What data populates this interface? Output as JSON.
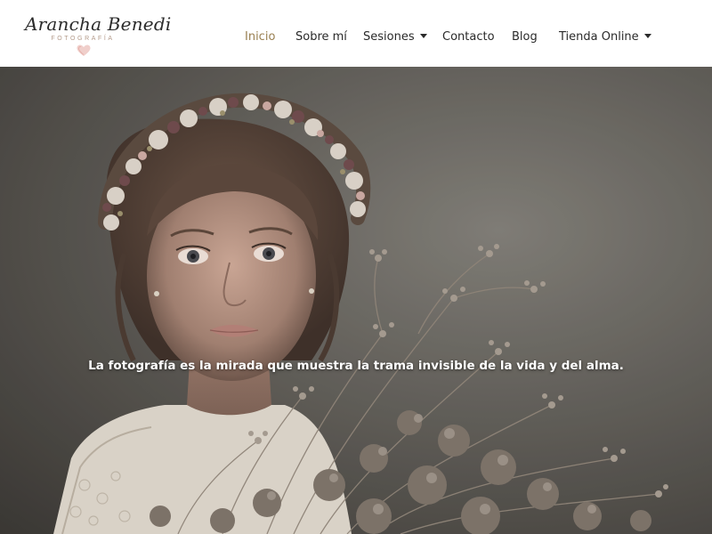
{
  "logo": {
    "name": "Arancha Benedi",
    "subtitle": "FOTOGRAFÍA"
  },
  "nav": {
    "items": [
      {
        "label": "Inicio",
        "active": true,
        "has_dropdown": false
      },
      {
        "label": "Sobre mí",
        "active": false,
        "has_dropdown": false
      },
      {
        "label": "Sesiones",
        "active": false,
        "has_dropdown": true
      },
      {
        "label": "Contacto",
        "active": false,
        "has_dropdown": false
      },
      {
        "label": "Blog",
        "active": false,
        "has_dropdown": false
      },
      {
        "label": "Tienda Online",
        "active": false,
        "has_dropdown": true
      }
    ]
  },
  "hero": {
    "quote": "La fotografía es la mirada que muestra la trama invisible de la vida y del alma."
  },
  "colors": {
    "active_nav": "#9a8052",
    "nav_text": "#2a2a2a",
    "header_bg": "#ffffff",
    "heart": "#e8b8b4"
  }
}
